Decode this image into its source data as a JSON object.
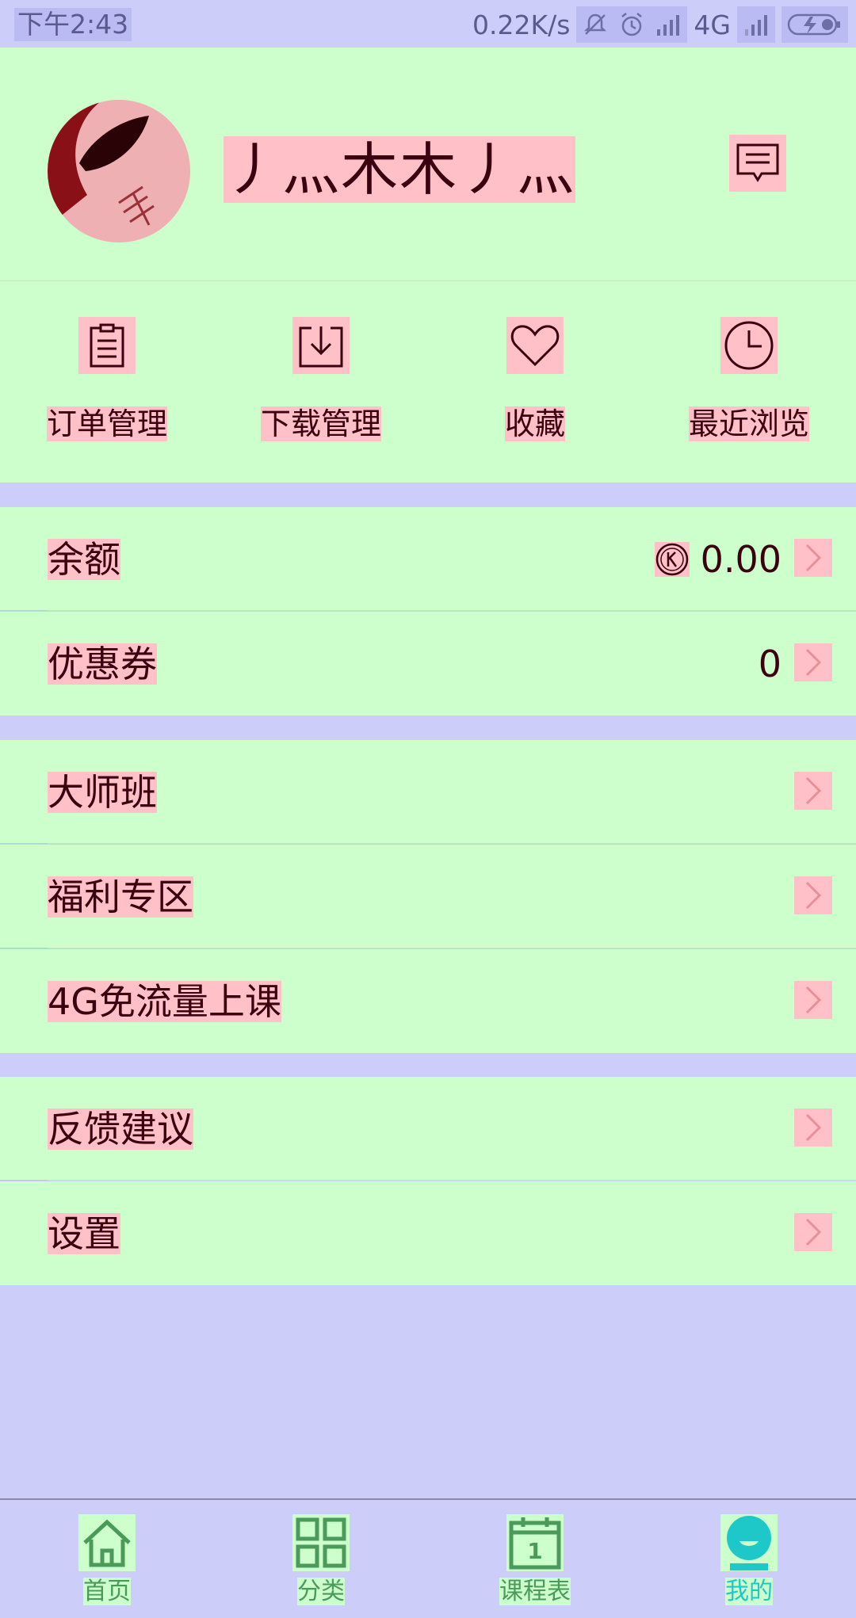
{
  "status_bar": {
    "time": "下午2:43",
    "net_speed": "0.22K/s",
    "network": "4G"
  },
  "profile": {
    "username": "丿灬木木丿灬"
  },
  "quick_actions": [
    {
      "label": "订单管理",
      "icon": "clipboard-icon"
    },
    {
      "label": "下载管理",
      "icon": "download-icon"
    },
    {
      "label": "收藏",
      "icon": "heart-icon"
    },
    {
      "label": "最近浏览",
      "icon": "clock-icon"
    }
  ],
  "wallet": {
    "balance_label": "余额",
    "balance_value": "0.00",
    "coupon_label": "优惠券",
    "coupon_value": "0"
  },
  "features": {
    "masterclass": "大师班",
    "welfare": "福利专区",
    "free_data": "4G免流量上课"
  },
  "misc": {
    "feedback": "反馈建议",
    "settings": "设置"
  },
  "bottom_nav": [
    {
      "label": "首页",
      "icon": "home-icon"
    },
    {
      "label": "分类",
      "icon": "grid-icon"
    },
    {
      "label": "课程表",
      "icon": "calendar-icon",
      "calendar_day": "1"
    },
    {
      "label": "我的",
      "icon": "profile-icon",
      "active": true
    }
  ],
  "colors": {
    "page_bg": "#cccdf9",
    "section_bg": "#ccffcc",
    "highlight": "#ffc0c8",
    "nav_green": "#4a9a5a",
    "nav_active": "#1ec8c8"
  }
}
